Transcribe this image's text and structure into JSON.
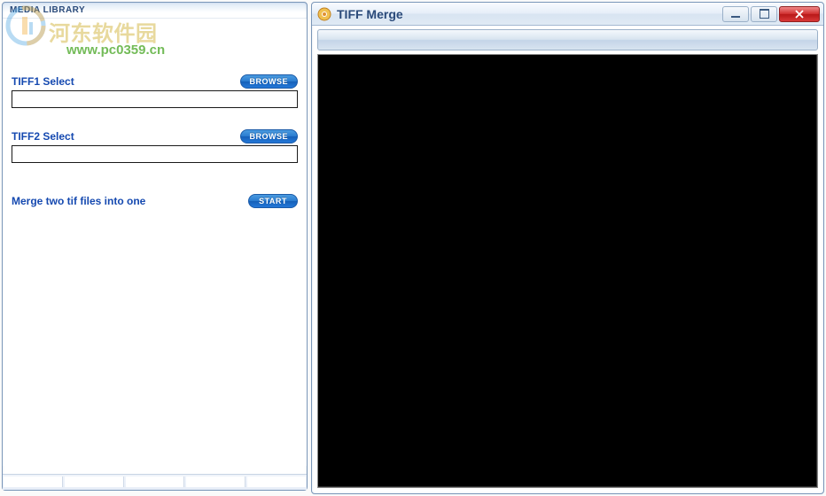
{
  "watermark": {
    "text_line1": "河东软件园",
    "text_line2": "www.pc0359.cn"
  },
  "left_panel": {
    "header": "MEDIA LIBRARY",
    "tiff1": {
      "label": "TIFF1 Select",
      "button": "BROWSE",
      "value": ""
    },
    "tiff2": {
      "label": "TIFF2 Select",
      "button": "BROWSE",
      "value": ""
    },
    "merge": {
      "label": "Merge two tif files into one",
      "button": "START"
    }
  },
  "right_window": {
    "title": "TIFF Merge"
  }
}
